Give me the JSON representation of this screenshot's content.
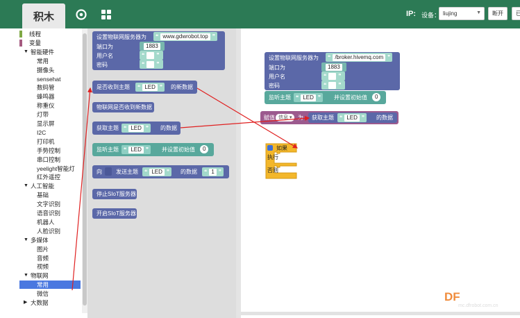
{
  "header": {
    "title": "积木",
    "ip_label": "IP:",
    "device_label": "设备：",
    "device_value": "liujing",
    "disconnect_label": "断开",
    "edge_label": "已",
    "colors": {
      "bar": "#2c7a55",
      "title_tab": "#e9e9e9"
    }
  },
  "sidebar": {
    "items": [
      {
        "label": "线程",
        "color": "#7fa845",
        "level": 0,
        "arrow": ""
      },
      {
        "label": "变量",
        "color": "#a55b80",
        "level": 0,
        "arrow": ""
      },
      {
        "label": "智能硬件",
        "level": 0,
        "arrow": "▼"
      },
      {
        "label": "常用",
        "level": 1
      },
      {
        "label": "摄像头",
        "level": 1
      },
      {
        "label": "sensehat",
        "level": 1
      },
      {
        "label": "数码管",
        "level": 1
      },
      {
        "label": "蜂鸣器",
        "level": 1
      },
      {
        "label": "称重仪",
        "level": 1
      },
      {
        "label": "灯带",
        "level": 1
      },
      {
        "label": "显示屏",
        "level": 1
      },
      {
        "label": "I2C",
        "level": 1
      },
      {
        "label": "打印机",
        "level": 1
      },
      {
        "label": "手势控制",
        "level": 1
      },
      {
        "label": "串口控制",
        "level": 1
      },
      {
        "label": "yeelight智能灯",
        "level": 1
      },
      {
        "label": "红外遥控",
        "level": 1
      },
      {
        "label": "人工智能",
        "level": 0,
        "arrow": "▼"
      },
      {
        "label": "基础",
        "level": 1
      },
      {
        "label": "文字识别",
        "level": 1
      },
      {
        "label": "语音识别",
        "level": 1
      },
      {
        "label": "机器人",
        "level": 1
      },
      {
        "label": "人脸识别",
        "level": 1
      },
      {
        "label": "多媒体",
        "level": 0,
        "arrow": "▼"
      },
      {
        "label": "图片",
        "level": 1
      },
      {
        "label": "音频",
        "level": 1
      },
      {
        "label": "视频",
        "level": 1
      },
      {
        "label": "物联网",
        "level": 0,
        "arrow": "▼"
      },
      {
        "label": "常用",
        "level": 1,
        "selected": true
      },
      {
        "label": "微信",
        "level": 1
      },
      {
        "label": "大数据",
        "level": 0,
        "arrow": "▶"
      }
    ]
  },
  "flyout": {
    "set_server_label": "设置物联网服务器为",
    "server_value": "www.gdwrobot.top",
    "port_label": "端口为",
    "port_value": "1883",
    "user_label": "用户名",
    "password_label": "密码",
    "received_label": "是否收到主题",
    "topic_value": "LED",
    "new_data_label": "的新数据",
    "iot_received_label": "物联网是否收到新数据",
    "get_topic_label": "获取主题",
    "data_label": "的数据",
    "listen_label": "监听主题",
    "init_label": "并设置初始值",
    "init_value": "0",
    "to_label": "向",
    "send_label": "发送主题",
    "send_value": "1",
    "stop_label": "停止SIoT服务器",
    "start_label": "开启SIoT服务器"
  },
  "workspace": {
    "server_value": "/broker.hivemq.com",
    "port_value": "1883",
    "assign_label": "赋值",
    "var_name": "信息",
    "as_label": "为",
    "if_label": "如果",
    "do_label": "执行",
    "else_label": "否则"
  },
  "branding": {
    "logo": "DF",
    "watermark": "mc.dfrobot.com.cn"
  }
}
